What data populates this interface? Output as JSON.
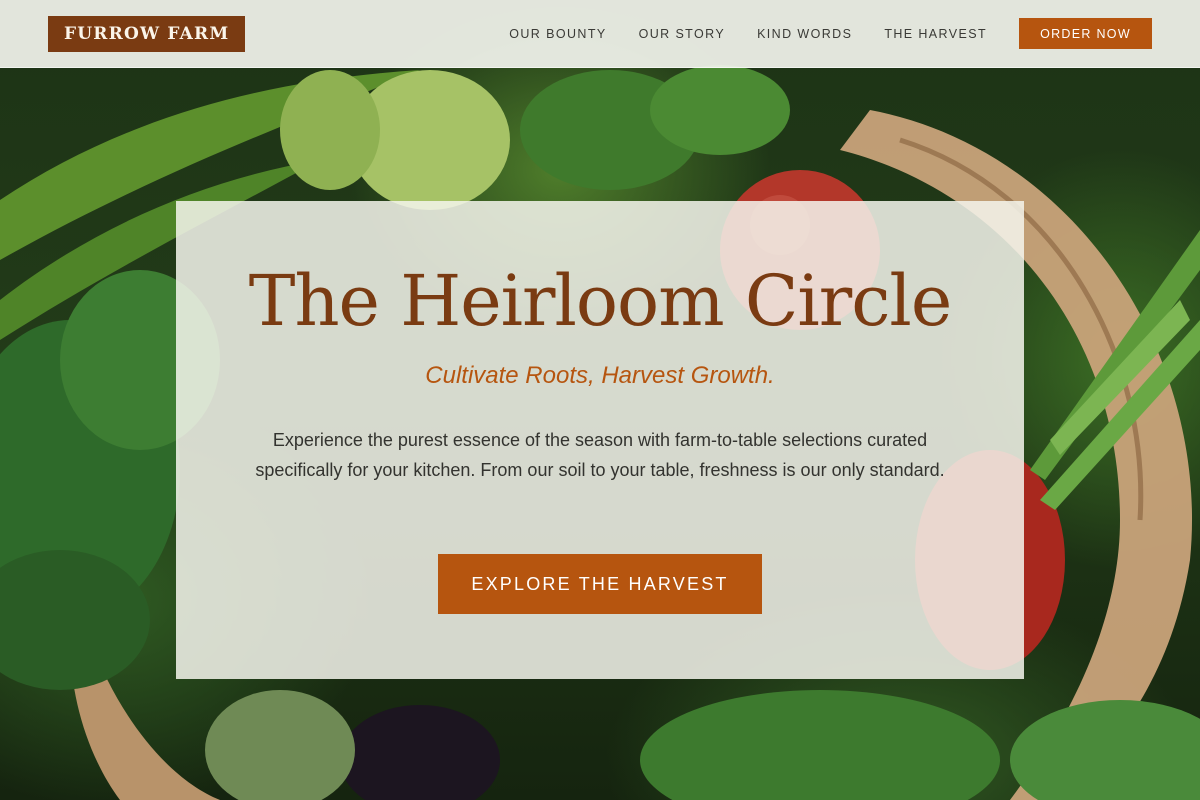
{
  "header": {
    "logo_text": "FURROW FARM",
    "nav": [
      {
        "label": "OUR BOUNTY"
      },
      {
        "label": "OUR STORY"
      },
      {
        "label": "KIND WORDS"
      },
      {
        "label": "THE HARVEST"
      }
    ],
    "order_button": "ORDER NOW"
  },
  "hero": {
    "title": "The Heirloom Circle",
    "tagline": "Cultivate Roots, Harvest Growth.",
    "body": "Experience the purest essence of the season with farm-to-table selections curated specifically for your kitchen. From our soil to your table, freshness is our only standard.",
    "cta": "EXPLORE THE HARVEST"
  },
  "colors": {
    "brand_brown": "#7a3b12",
    "accent_orange": "#b6550f",
    "header_bg": "#f1f3ec",
    "text_dark": "#33332f"
  }
}
